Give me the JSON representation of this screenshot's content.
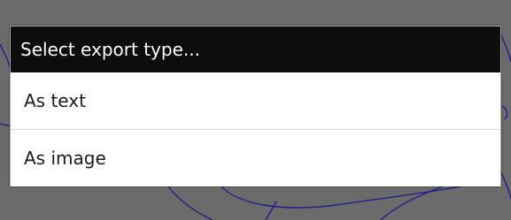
{
  "dialog": {
    "title": "Select export type...",
    "options": [
      {
        "label": "As text"
      },
      {
        "label": "As image"
      }
    ]
  },
  "colors": {
    "dim_overlay": "#6b6b6b",
    "title_bar": "#0d0d0d",
    "drawing_stroke": "#1f1f8a"
  }
}
